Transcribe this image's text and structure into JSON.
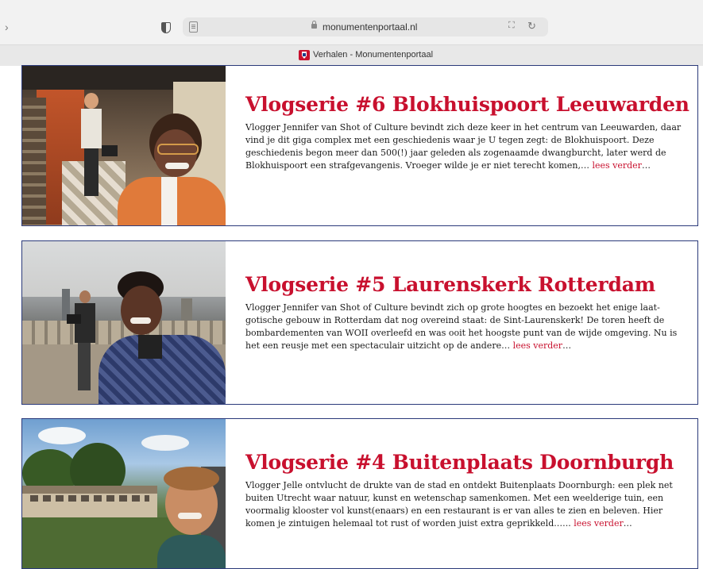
{
  "browser": {
    "url": "monumentenportaal.nl",
    "tab_title": "Verhalen - Monumentenportaal"
  },
  "articles": [
    {
      "title": "Vlogserie #6 Blokhuispoort Leeuwarden",
      "text": "Vlogger Jennifer van Shot of Culture bevindt zich deze keer in het centrum van Leeuwarden, daar vind je dit giga complex met een geschiedenis waar je U tegen zegt: de Blokhuispoort. Deze geschiedenis begon meer dan 500(!) jaar geleden als zogenaamde dwangburcht, later werd de Blokhuispoort een strafgevangenis. Vroeger wilde je er niet terecht komen,…",
      "more": "lees verder",
      "ellipsis": "…"
    },
    {
      "title": "Vlogserie #5 Laurenskerk Rotterdam",
      "text": "Vlogger Jennifer van Shot of Culture bevindt zich op grote hoogtes en bezoekt het enige laat-gotische gebouw in Rotterdam dat nog overeind staat: de Sint-Laurenskerk! De toren heeft de bombardementen van WOII overleefd en was ooit het hoogste punt van de wijde omgeving. Nu is het een reusje met een spectaculair uitzicht op de andere…",
      "more": "lees verder",
      "ellipsis": "…"
    },
    {
      "title": "Vlogserie #4 Buitenplaats Doornburgh",
      "text": "Vlogger Jelle ontvlucht de drukte van de stad en ontdekt Buitenplaats Doornburgh: een plek net buiten Utrecht waar natuur, kunst en wetenschap samenkomen. Met een weelderige tuin, een voormalig klooster vol kunst(enaars) en een restaurant is er van alles te zien en beleven. Hier komen je zintuigen helemaal tot rust of worden juist extra geprikkeld.…..",
      "more": "lees verder",
      "ellipsis": "…"
    }
  ],
  "colors": {
    "accent": "#c8102e",
    "border": "#2b3a7a"
  }
}
